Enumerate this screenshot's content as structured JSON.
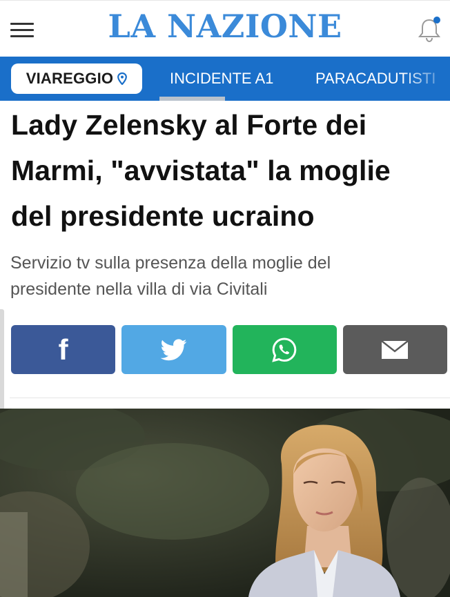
{
  "header": {
    "logo_text": "LA NAZIONE",
    "menu_icon": "hamburger-menu-icon",
    "notification_icon": "bell-icon",
    "brand_color": "#3b8ad9"
  },
  "nav": {
    "city": "VIAREGGIO",
    "city_icon": "location-pin-icon",
    "items": [
      "INCIDENTE A1",
      "PARACADUTISTI"
    ],
    "bar_color": "#1a6fc9"
  },
  "article": {
    "headline_lines": [
      "Lady Zelensky al Forte dei",
      "Marmi, \"avvistata\" la moglie",
      "del presidente ucraino"
    ],
    "subtitle_lines": [
      "Servizio tv sulla presenza della moglie del",
      "presidente nella villa di via Civitali"
    ]
  },
  "share": {
    "buttons": [
      {
        "icon": "facebook-icon",
        "color": "#3b5998"
      },
      {
        "icon": "twitter-icon",
        "color": "#52a8e4"
      },
      {
        "icon": "whatsapp-icon",
        "color": "#22b45b"
      },
      {
        "icon": "email-icon",
        "color": "#5b5b5b"
      }
    ],
    "facebook_glyph": "f"
  }
}
